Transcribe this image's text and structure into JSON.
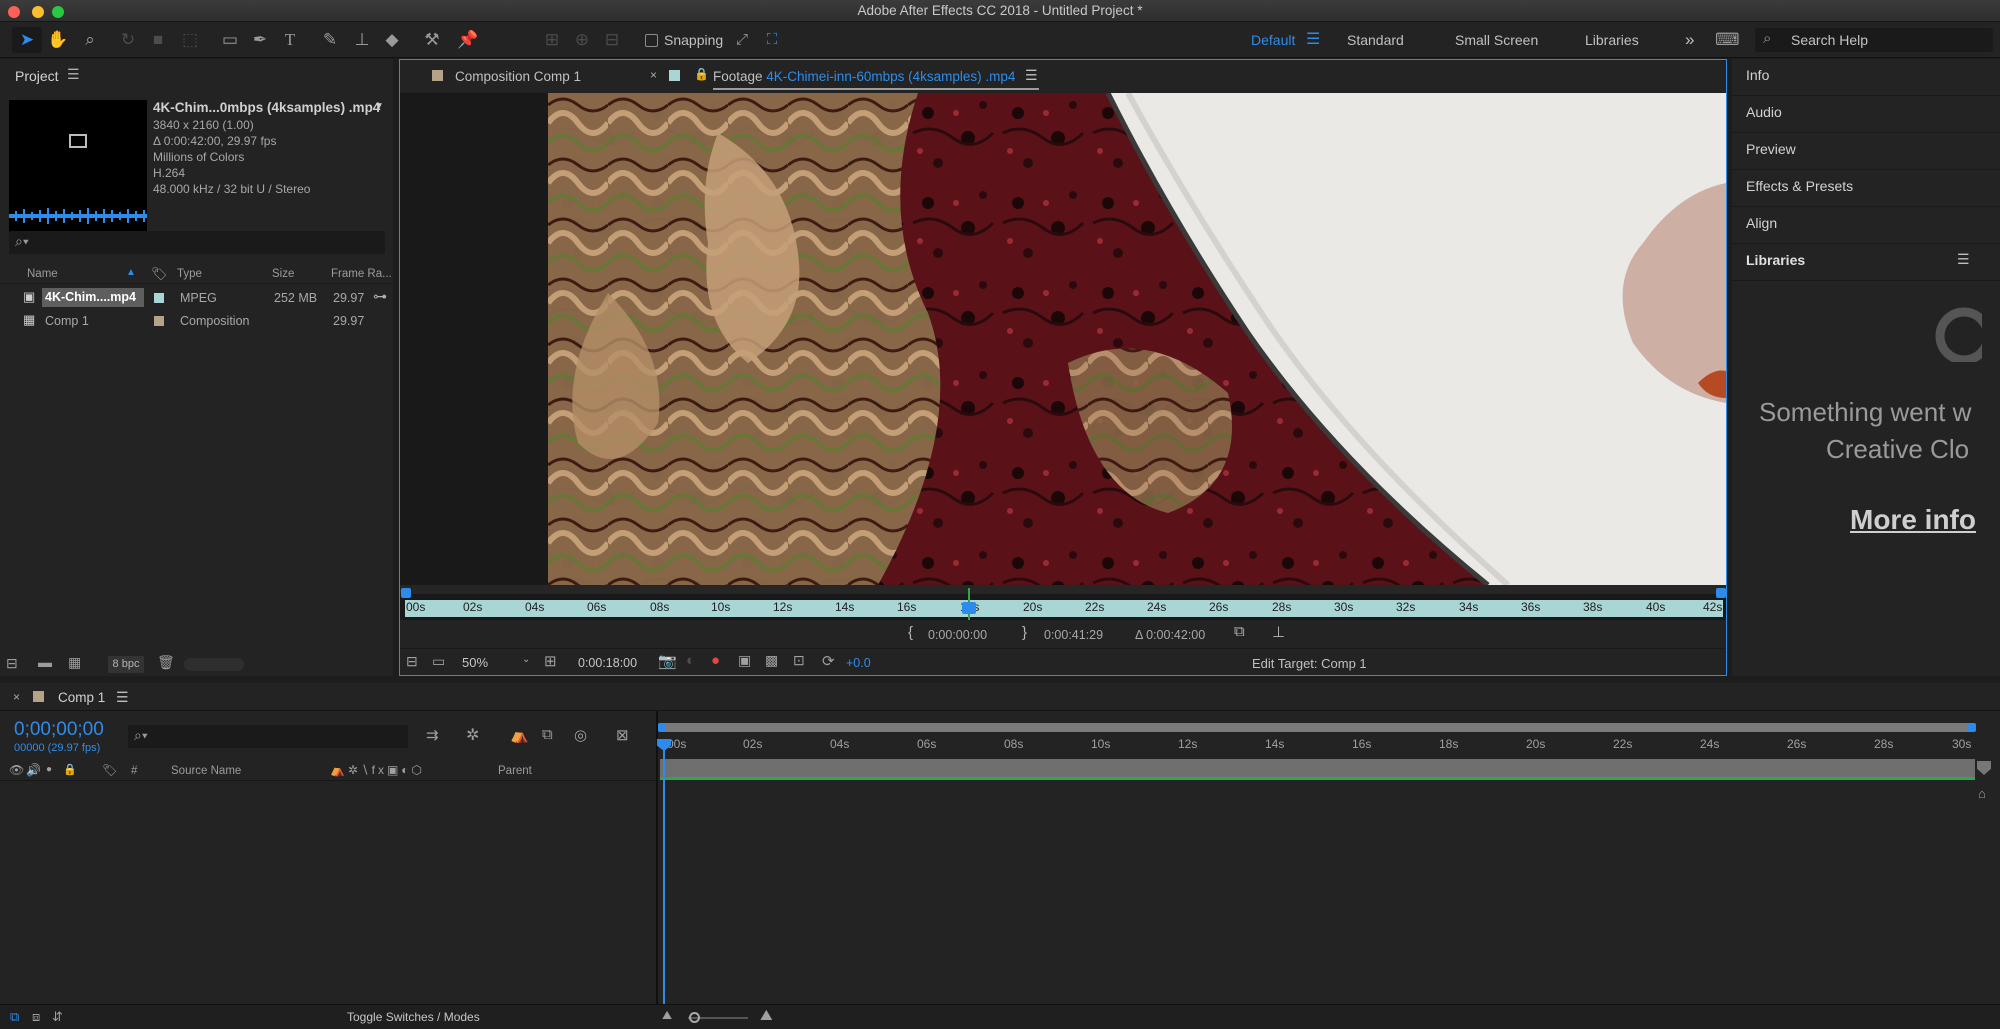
{
  "app": {
    "window_title": "Adobe After Effects CC 2018 - Untitled Project *",
    "traffic_colors": [
      "#fe5f57",
      "#febc2e",
      "#28c840"
    ]
  },
  "toolbar": {
    "snapping_label": "Snapping",
    "workspaces": [
      "Default",
      "Standard",
      "Small Screen",
      "Libraries"
    ],
    "active_workspace": "Default",
    "more_icon": "»",
    "search_placeholder": "Search Help",
    "accent": "#2d8ceb"
  },
  "project": {
    "title": "Project",
    "footage_name": "4K-Chim...0mbps (4ksamples) .mp4",
    "info_lines": [
      "3840 x 2160 (1.00)",
      "Δ 0:00:42:00, 29.97 fps",
      "Millions of Colors",
      "H.264",
      "48.000 kHz / 32 bit U / Stereo"
    ],
    "search_placeholder": "",
    "columns": [
      "Name",
      "Type",
      "Size",
      "Frame Ra..."
    ],
    "items": [
      {
        "name": "4K-Chim....mp4",
        "type": "MPEG",
        "size": "252 MB",
        "fps": "29.97",
        "selected": true
      },
      {
        "name": "Comp 1",
        "type": "Composition",
        "size": "",
        "fps": "29.97",
        "selected": false
      }
    ],
    "bpc_label": "8 bpc"
  },
  "viewer": {
    "tabs": [
      {
        "label": "Composition Comp 1",
        "active": false
      },
      {
        "prefix": "Footage ",
        "label": "4K-Chimei-inn-60mbps (4ksamples) .mp4",
        "active": true
      }
    ],
    "ruler_ticks": [
      "00s",
      "02s",
      "04s",
      "06s",
      "08s",
      "10s",
      "12s",
      "14s",
      "16s",
      "18s",
      "20s",
      "22s",
      "24s",
      "26s",
      "28s",
      "30s",
      "32s",
      "34s",
      "36s",
      "38s",
      "40s",
      "42s"
    ],
    "in_point": "0:00:00:00",
    "out_point": "0:00:41:29",
    "duration": "Δ 0:00:42:00",
    "zoom": "50%",
    "current_time": "0:00:18:00",
    "exposure": "+0.0",
    "edit_target": "Edit Target: Comp 1"
  },
  "right_panel": {
    "items": [
      "Info",
      "Audio",
      "Preview",
      "Effects & Presets",
      "Align",
      "Libraries"
    ],
    "libraries_message_1": "Something went w",
    "libraries_message_2": "Creative Clo",
    "more_info": "More info"
  },
  "timeline": {
    "comp_tab": "Comp 1",
    "timecode": "0;00;00;00",
    "frame_info": "00000 (29.97 fps)",
    "search_placeholder": "",
    "column_source": "Source Name",
    "column_parent": "Parent",
    "column_hash": "#",
    "ruler_ticks": [
      "00s",
      "02s",
      "04s",
      "06s",
      "08s",
      "10s",
      "12s",
      "14s",
      "16s",
      "18s",
      "20s",
      "22s",
      "24s",
      "26s",
      "28s",
      "30s"
    ],
    "toggle_label": "Toggle Switches / Modes"
  }
}
